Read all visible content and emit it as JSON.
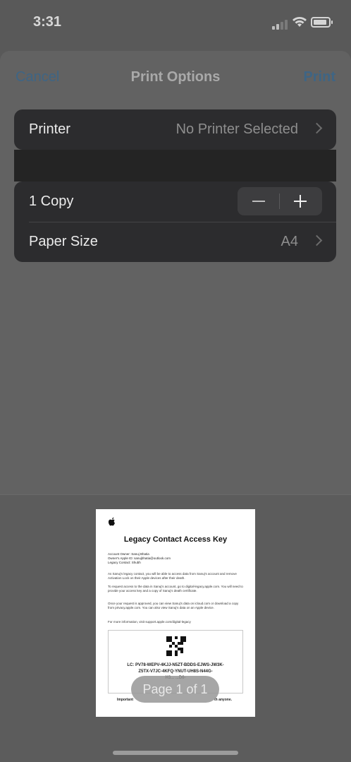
{
  "status_bar": {
    "time": "3:31"
  },
  "nav": {
    "cancel_label": "Cancel",
    "title": "Print Options",
    "print_label": "Print"
  },
  "printer_row": {
    "label": "Printer",
    "value": "No Printer Selected"
  },
  "copies_row": {
    "label": "1 Copy",
    "count": 1
  },
  "paper_row": {
    "label": "Paper Size",
    "value": "A4"
  },
  "preview": {
    "doc_title": "Legacy Contact Access Key",
    "meta_owner": "Account Owner: Sanuj Bhatia",
    "meta_apple_id": "Owner's Apple ID: sanujbhatia@outlook.com",
    "meta_contact": "Legacy Contact: Shubh",
    "para1": "As Sanuj's legacy contact, you will be able to access data from Sanuj's account and remove Activation Lock on their Apple devices after their death.",
    "para2": "To request access to the data in Sanuj's account, go to digital-legacy.apple.com. You will need to provide your access key and a copy of Sanuj's death certificate.",
    "para3": "Once your request is approved, you can view Sanuj's data on icloud.com or download a copy from privacy.apple.com. You can also view Sanuj's data on an Apple device.",
    "para4": "For more information, visit support.apple.com/digital-legacy",
    "code_line1": "LC: PV78-WEPV-4KJJ-N5ZT-BDDS-EJWS-JW3K-",
    "code_line2": "Z5TX-V7JC-4KFQ-YNUT-UH8S-N44G-",
    "code_line3": "H3...                          ...D6-",
    "important_left": "Important",
    "important_right": "th anyone.",
    "page_indicator": "Page 1 of 1"
  },
  "colors": {
    "accent": "#3e6585",
    "group_bg": "#2c2c2e",
    "sheet_bg": "#626262"
  }
}
